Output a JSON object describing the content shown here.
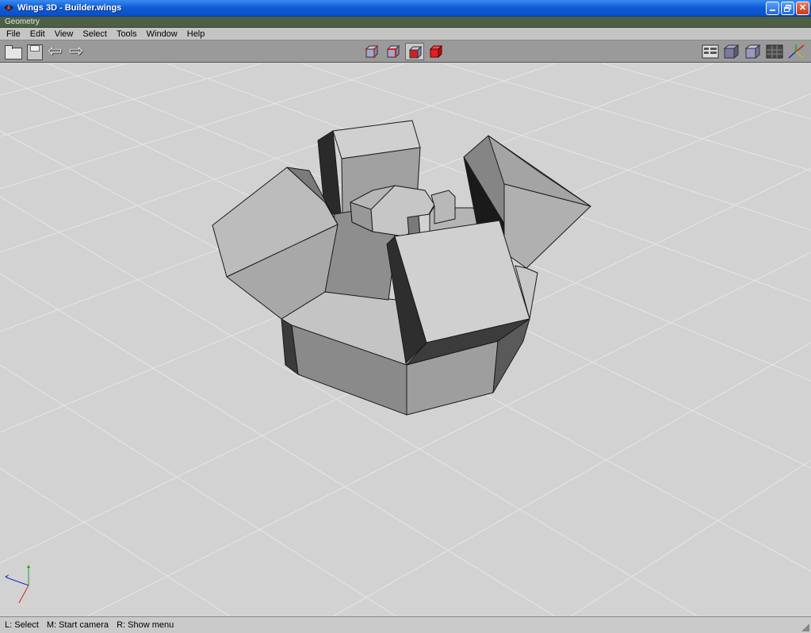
{
  "window": {
    "title": "Wings 3D - Builder.wings"
  },
  "panel": {
    "title": "Geometry"
  },
  "menu": {
    "items": [
      "File",
      "Edit",
      "View",
      "Select",
      "Tools",
      "Window",
      "Help"
    ]
  },
  "toolbar": {
    "left_icons": [
      "open-folder-icon",
      "save-disk-icon",
      "undo-arrow-icon",
      "redo-arrow-icon"
    ],
    "selection_modes": [
      "vertex-select-icon",
      "edge-select-icon",
      "face-select-icon",
      "body-select-icon"
    ],
    "active_selection_mode": "face-select-icon",
    "right_icons": [
      "wireframe-toggle-icon",
      "smooth-shade-icon",
      "flat-shade-icon",
      "ground-plane-icon",
      "axes-icon"
    ]
  },
  "status": {
    "left": "L: Select",
    "middle": "M: Start camera",
    "right": "R: Show menu"
  },
  "colors": {
    "titlebar": "#0f5ed9",
    "panel": "#4c6046",
    "viewport_bg": "#d2d2d2",
    "grid": "#e4e4e4",
    "axis_x": "#d02020",
    "axis_y": "#20a020",
    "axis_z": "#2020d0"
  }
}
